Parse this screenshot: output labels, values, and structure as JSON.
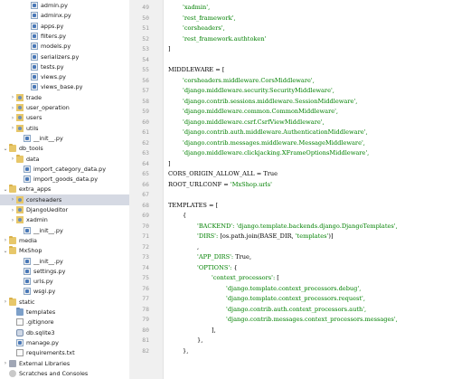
{
  "project_tree": {
    "items": [
      {
        "label": "admin.py",
        "indent": 24,
        "icon": "py",
        "arrow": ""
      },
      {
        "label": "adminx.py",
        "indent": 24,
        "icon": "py",
        "arrow": ""
      },
      {
        "label": "apps.py",
        "indent": 24,
        "icon": "py",
        "arrow": ""
      },
      {
        "label": "filters.py",
        "indent": 24,
        "icon": "py",
        "arrow": ""
      },
      {
        "label": "models.py",
        "indent": 24,
        "icon": "py",
        "arrow": ""
      },
      {
        "label": "serializers.py",
        "indent": 24,
        "icon": "py",
        "arrow": ""
      },
      {
        "label": "tests.py",
        "indent": 24,
        "icon": "py",
        "arrow": ""
      },
      {
        "label": "views.py",
        "indent": 24,
        "icon": "py",
        "arrow": ""
      },
      {
        "label": "views_base.py",
        "indent": 24,
        "icon": "py",
        "arrow": ""
      },
      {
        "label": "trade",
        "indent": 8,
        "icon": "pkg",
        "arrow": "›"
      },
      {
        "label": "user_operation",
        "indent": 8,
        "icon": "pkg",
        "arrow": "›"
      },
      {
        "label": "users",
        "indent": 8,
        "icon": "pkg",
        "arrow": "›"
      },
      {
        "label": "utils",
        "indent": 8,
        "icon": "pkg",
        "arrow": "›"
      },
      {
        "label": "__init__.py",
        "indent": 16,
        "icon": "py",
        "arrow": ""
      },
      {
        "label": "db_tools",
        "indent": 0,
        "icon": "folder",
        "arrow": "⌄"
      },
      {
        "label": "data",
        "indent": 8,
        "icon": "folder",
        "arrow": "›"
      },
      {
        "label": "import_category_data.py",
        "indent": 16,
        "icon": "py",
        "arrow": ""
      },
      {
        "label": "import_goods_data.py",
        "indent": 16,
        "icon": "py",
        "arrow": ""
      },
      {
        "label": "extra_apps",
        "indent": 0,
        "icon": "folder",
        "arrow": "⌄"
      },
      {
        "label": "corsheaders",
        "indent": 8,
        "icon": "pkg",
        "arrow": "›",
        "selected": true
      },
      {
        "label": "DjangoUeditor",
        "indent": 8,
        "icon": "pkg",
        "arrow": "›"
      },
      {
        "label": "xadmin",
        "indent": 8,
        "icon": "pkg",
        "arrow": "›"
      },
      {
        "label": "__init__.py",
        "indent": 16,
        "icon": "py",
        "arrow": ""
      },
      {
        "label": "media",
        "indent": 0,
        "icon": "folder",
        "arrow": "›"
      },
      {
        "label": "MxShop",
        "indent": 0,
        "icon": "folder",
        "arrow": "⌄"
      },
      {
        "label": "__init__.py",
        "indent": 16,
        "icon": "py",
        "arrow": ""
      },
      {
        "label": "settings.py",
        "indent": 16,
        "icon": "py",
        "arrow": ""
      },
      {
        "label": "urls.py",
        "indent": 16,
        "icon": "py",
        "arrow": ""
      },
      {
        "label": "wsgi.py",
        "indent": 16,
        "icon": "py",
        "arrow": ""
      },
      {
        "label": "static",
        "indent": 0,
        "icon": "folder",
        "arrow": "›"
      },
      {
        "label": "templates",
        "indent": 8,
        "icon": "folder-blue",
        "arrow": ""
      },
      {
        "label": ".gitignore",
        "indent": 8,
        "icon": "txt",
        "arrow": ""
      },
      {
        "label": "db.sqlite3",
        "indent": 8,
        "icon": "db",
        "arrow": ""
      },
      {
        "label": "manage.py",
        "indent": 8,
        "icon": "py",
        "arrow": ""
      },
      {
        "label": "requirements.txt",
        "indent": 8,
        "icon": "txt",
        "arrow": ""
      },
      {
        "label": "External Libraries",
        "indent": 0,
        "icon": "lib",
        "arrow": "›"
      },
      {
        "label": "Scratches and Consoles",
        "indent": 0,
        "icon": "scratch",
        "arrow": ""
      }
    ]
  },
  "editor": {
    "lines": [
      {
        "n": "49",
        "segs": [
          {
            "t": "'xadmin',",
            "c": "str",
            "i": 16
          }
        ]
      },
      {
        "n": "50",
        "segs": [
          {
            "t": "'rest_framework',",
            "c": "str",
            "i": 16
          }
        ]
      },
      {
        "n": "51",
        "segs": [
          {
            "t": "'corsheaders',",
            "c": "str",
            "i": 16
          }
        ]
      },
      {
        "n": "52",
        "segs": [
          {
            "t": "'rest_framework.authtoken'",
            "c": "str",
            "i": 16
          }
        ]
      },
      {
        "n": "53",
        "segs": [
          {
            "t": "]",
            "c": "plain",
            "i": 0
          }
        ]
      },
      {
        "n": "54",
        "segs": []
      },
      {
        "n": "55",
        "segs": [
          {
            "t": "MIDDLEWARE = [",
            "c": "plain",
            "i": 0
          }
        ]
      },
      {
        "n": "56",
        "segs": [
          {
            "t": "'corsheaders.middleware.CorsMiddleware',",
            "c": "str",
            "i": 16
          }
        ]
      },
      {
        "n": "57",
        "segs": [
          {
            "t": "'django.middleware.security.SecurityMiddleware',",
            "c": "str",
            "i": 16
          }
        ]
      },
      {
        "n": "58",
        "segs": [
          {
            "t": "'django.contrib.sessions.middleware.SessionMiddleware',",
            "c": "str",
            "i": 16
          }
        ]
      },
      {
        "n": "59",
        "segs": [
          {
            "t": "'django.middleware.common.CommonMiddleware',",
            "c": "str",
            "i": 16
          }
        ]
      },
      {
        "n": "60",
        "segs": [
          {
            "t": "'django.middleware.csrf.CsrfViewMiddleware',",
            "c": "str",
            "i": 16
          }
        ]
      },
      {
        "n": "61",
        "segs": [
          {
            "t": "'django.contrib.auth.middleware.AuthenticationMiddleware',",
            "c": "str",
            "i": 16
          }
        ]
      },
      {
        "n": "62",
        "segs": [
          {
            "t": "'django.contrib.messages.middleware.MessageMiddleware',",
            "c": "str",
            "i": 16
          }
        ]
      },
      {
        "n": "63",
        "segs": [
          {
            "t": "'django.middleware.clickjacking.XFrameOptionsMiddleware',",
            "c": "str",
            "i": 16
          }
        ]
      },
      {
        "n": "64",
        "segs": [
          {
            "t": "]",
            "c": "plain",
            "i": 0
          }
        ]
      },
      {
        "n": "65",
        "segs": [
          {
            "t": "CORS_ORIGIN_ALLOW_ALL = True",
            "c": "plain",
            "i": 0
          }
        ]
      },
      {
        "n": "66",
        "segs": [
          {
            "t": "ROOT_URLCONF = ",
            "c": "plain",
            "i": 0
          },
          {
            "t": "'MxShop.urls'",
            "c": "str",
            "i": 0
          }
        ]
      },
      {
        "n": "67",
        "segs": []
      },
      {
        "n": "68",
        "segs": [
          {
            "t": "TEMPLATES = [",
            "c": "plain",
            "i": 0
          }
        ]
      },
      {
        "n": "69",
        "segs": [
          {
            "t": "{",
            "c": "plain",
            "i": 16
          }
        ]
      },
      {
        "n": "70",
        "segs": [
          {
            "t": "'BACKEND': ",
            "c": "str",
            "i": 32
          },
          {
            "t": "'django.template.backends.django.DjangoTemplates',",
            "c": "str",
            "i": 0
          }
        ]
      },
      {
        "n": "71",
        "segs": [
          {
            "t": "'DIRS': ",
            "c": "str",
            "i": 32
          },
          {
            "t": "[os.path.join(BASE_DIR, ",
            "c": "plain",
            "i": 0
          },
          {
            "t": "'templates'",
            "c": "str",
            "i": 0
          },
          {
            "t": ")]",
            "c": "plain",
            "i": 0
          }
        ]
      },
      {
        "n": "72",
        "segs": [
          {
            "t": ",",
            "c": "plain",
            "i": 32
          }
        ]
      },
      {
        "n": "73",
        "segs": [
          {
            "t": "'APP_DIRS': ",
            "c": "str",
            "i": 32
          },
          {
            "t": "True,",
            "c": "plain",
            "i": 0
          }
        ]
      },
      {
        "n": "74",
        "segs": [
          {
            "t": "'OPTIONS': ",
            "c": "str",
            "i": 32
          },
          {
            "t": "{",
            "c": "plain",
            "i": 0
          }
        ]
      },
      {
        "n": "75",
        "segs": [
          {
            "t": "'context_processors': ",
            "c": "str",
            "i": 48
          },
          {
            "t": "[",
            "c": "plain",
            "i": 0
          }
        ]
      },
      {
        "n": "76",
        "segs": [
          {
            "t": "'django.template.context_processors.debug',",
            "c": "str",
            "i": 64
          }
        ]
      },
      {
        "n": "77",
        "segs": [
          {
            "t": "'django.template.context_processors.request',",
            "c": "str",
            "i": 64
          }
        ]
      },
      {
        "n": "78",
        "segs": [
          {
            "t": "'django.contrib.auth.context_processors.auth',",
            "c": "str",
            "i": 64
          }
        ]
      },
      {
        "n": "79",
        "segs": [
          {
            "t": "'django.contrib.messages.context_processors.messages',",
            "c": "str",
            "i": 64
          }
        ]
      },
      {
        "n": "80",
        "segs": [
          {
            "t": "],",
            "c": "plain",
            "i": 48
          }
        ]
      },
      {
        "n": "81",
        "segs": [
          {
            "t": "},",
            "c": "plain",
            "i": 32
          }
        ]
      },
      {
        "n": "82",
        "segs": [
          {
            "t": "},",
            "c": "plain",
            "i": 16
          }
        ]
      }
    ]
  }
}
